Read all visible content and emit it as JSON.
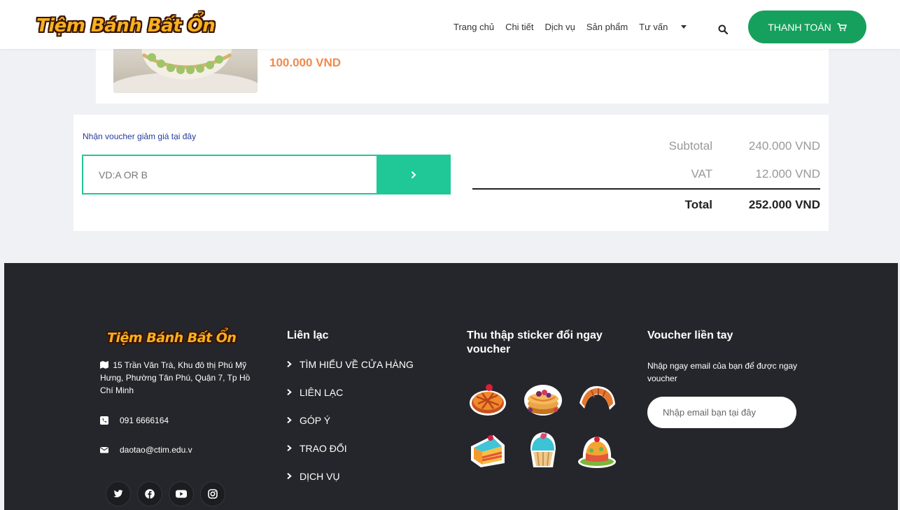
{
  "brand": {
    "logo_text": "Tiệm Bánh Bất Ổn"
  },
  "header": {
    "nav": [
      {
        "label": "Trang chủ"
      },
      {
        "label": "Chi tiết"
      },
      {
        "label": "Dịch vụ"
      },
      {
        "label": "Sản phẩm"
      },
      {
        "label": "Tư vấn",
        "has_dropdown": true
      }
    ],
    "search_icon": "search-icon",
    "checkout_label": "THANH TOÁN",
    "checkout_icon": "cart-icon",
    "accent_color": "#16a05d"
  },
  "product": {
    "price": "100.000 VND"
  },
  "cart": {
    "voucher_link": "Nhận voucher giảm giá tại đây",
    "voucher_placeholder": "VD:A OR B",
    "voucher_button_icon": "chevron-right-icon",
    "subtotal_label": "Subtotal",
    "subtotal_value": "240.000 VND",
    "vat_label": "VAT",
    "vat_value": "12.000 VND",
    "total_label": "Total",
    "total_value": "252.000 VND",
    "accent_color": "#20c797"
  },
  "footer": {
    "logo_text": "Tiệm Bánh Bất Ổn",
    "address": "15 Trần Văn Trà, Khu đô thị Phú Mỹ Hưng, Phường Tân Phú, Quận 7, Tp Hồ Chí Minh",
    "phone": "091 6666164",
    "email": "daotao@ctim.edu.v",
    "socials": [
      "twitter-icon",
      "facebook-icon",
      "youtube-icon",
      "instagram-icon"
    ],
    "contact_title": "Liên lạc",
    "contact_links": [
      "TÌM HIỂU VỀ CỬA HÀNG",
      "LIÊN LẠC",
      "GÓP Ý",
      "TRAO ĐỔI",
      "DỊCH VỤ"
    ],
    "sticker_title": "Thu thập sticker đổi ngay voucher",
    "stickers": [
      "pie-sticker",
      "pancake-sticker",
      "croissant-sticker",
      "cake-slice-sticker",
      "cupcake-sticker",
      "jelly-cake-sticker"
    ],
    "voucher_title": "Voucher liền tay",
    "voucher_desc": "Nhập ngay email của bạn để được ngay voucher",
    "email_placeholder": "Nhập email bạn tại đây",
    "background_color": "#25262b"
  }
}
